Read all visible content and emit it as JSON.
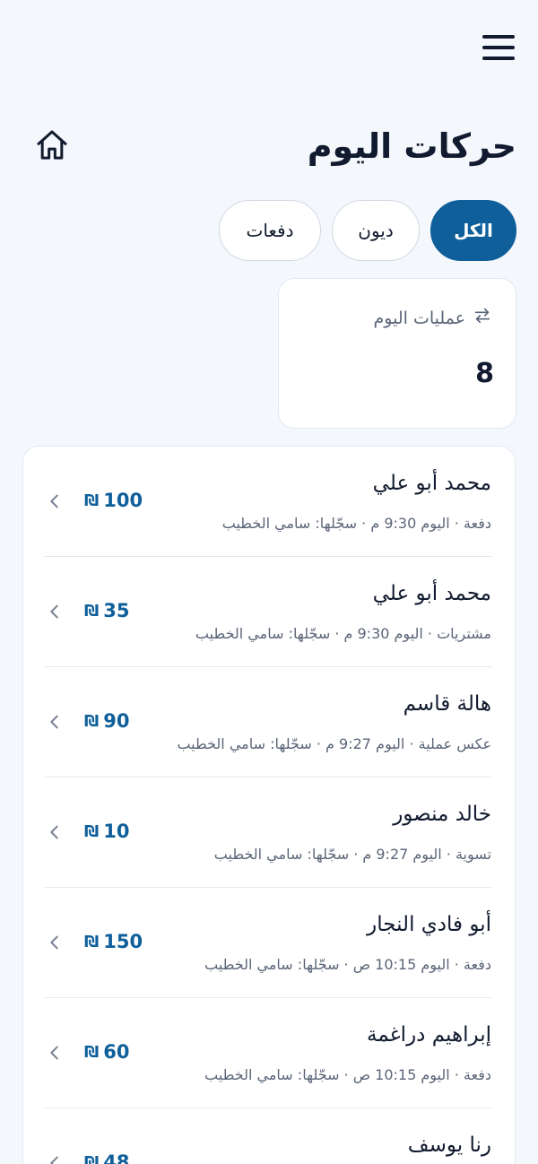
{
  "header": {
    "title": "حركات اليوم"
  },
  "filters": {
    "all": "الكل",
    "debts": "ديون",
    "payments": "دفعات",
    "active": "all"
  },
  "stat": {
    "label": "عمليات اليوم",
    "value": "8"
  },
  "currency_symbol": "₪",
  "colors": {
    "accent": "#0f5f9a",
    "text": "#111a2e",
    "muted": "#5b6578",
    "background": "#f4f7fc"
  },
  "transactions": [
    {
      "name": "محمد أبو علي",
      "meta": "دفعة · اليوم 9:30 م · سجّلها: سامي الخطيب",
      "amount": "100"
    },
    {
      "name": "محمد أبو علي",
      "meta": "مشتريات · اليوم 9:30 م · سجّلها: سامي الخطيب",
      "amount": "35"
    },
    {
      "name": "هالة قاسم",
      "meta": "عكس عملية · اليوم 9:27 م · سجّلها: سامي الخطيب",
      "amount": "90"
    },
    {
      "name": "خالد منصور",
      "meta": "تسوية · اليوم 9:27 م · سجّلها: سامي الخطيب",
      "amount": "10"
    },
    {
      "name": "أبو فادي النجار",
      "meta": "دفعة · اليوم 10:15 ص · سجّلها: سامي الخطيب",
      "amount": "150"
    },
    {
      "name": "إبراهيم دراغمة",
      "meta": "دفعة · اليوم 10:15 ص · سجّلها: سامي الخطيب",
      "amount": "60"
    },
    {
      "name": "رنا يوسف",
      "meta": "",
      "amount": "48"
    }
  ]
}
